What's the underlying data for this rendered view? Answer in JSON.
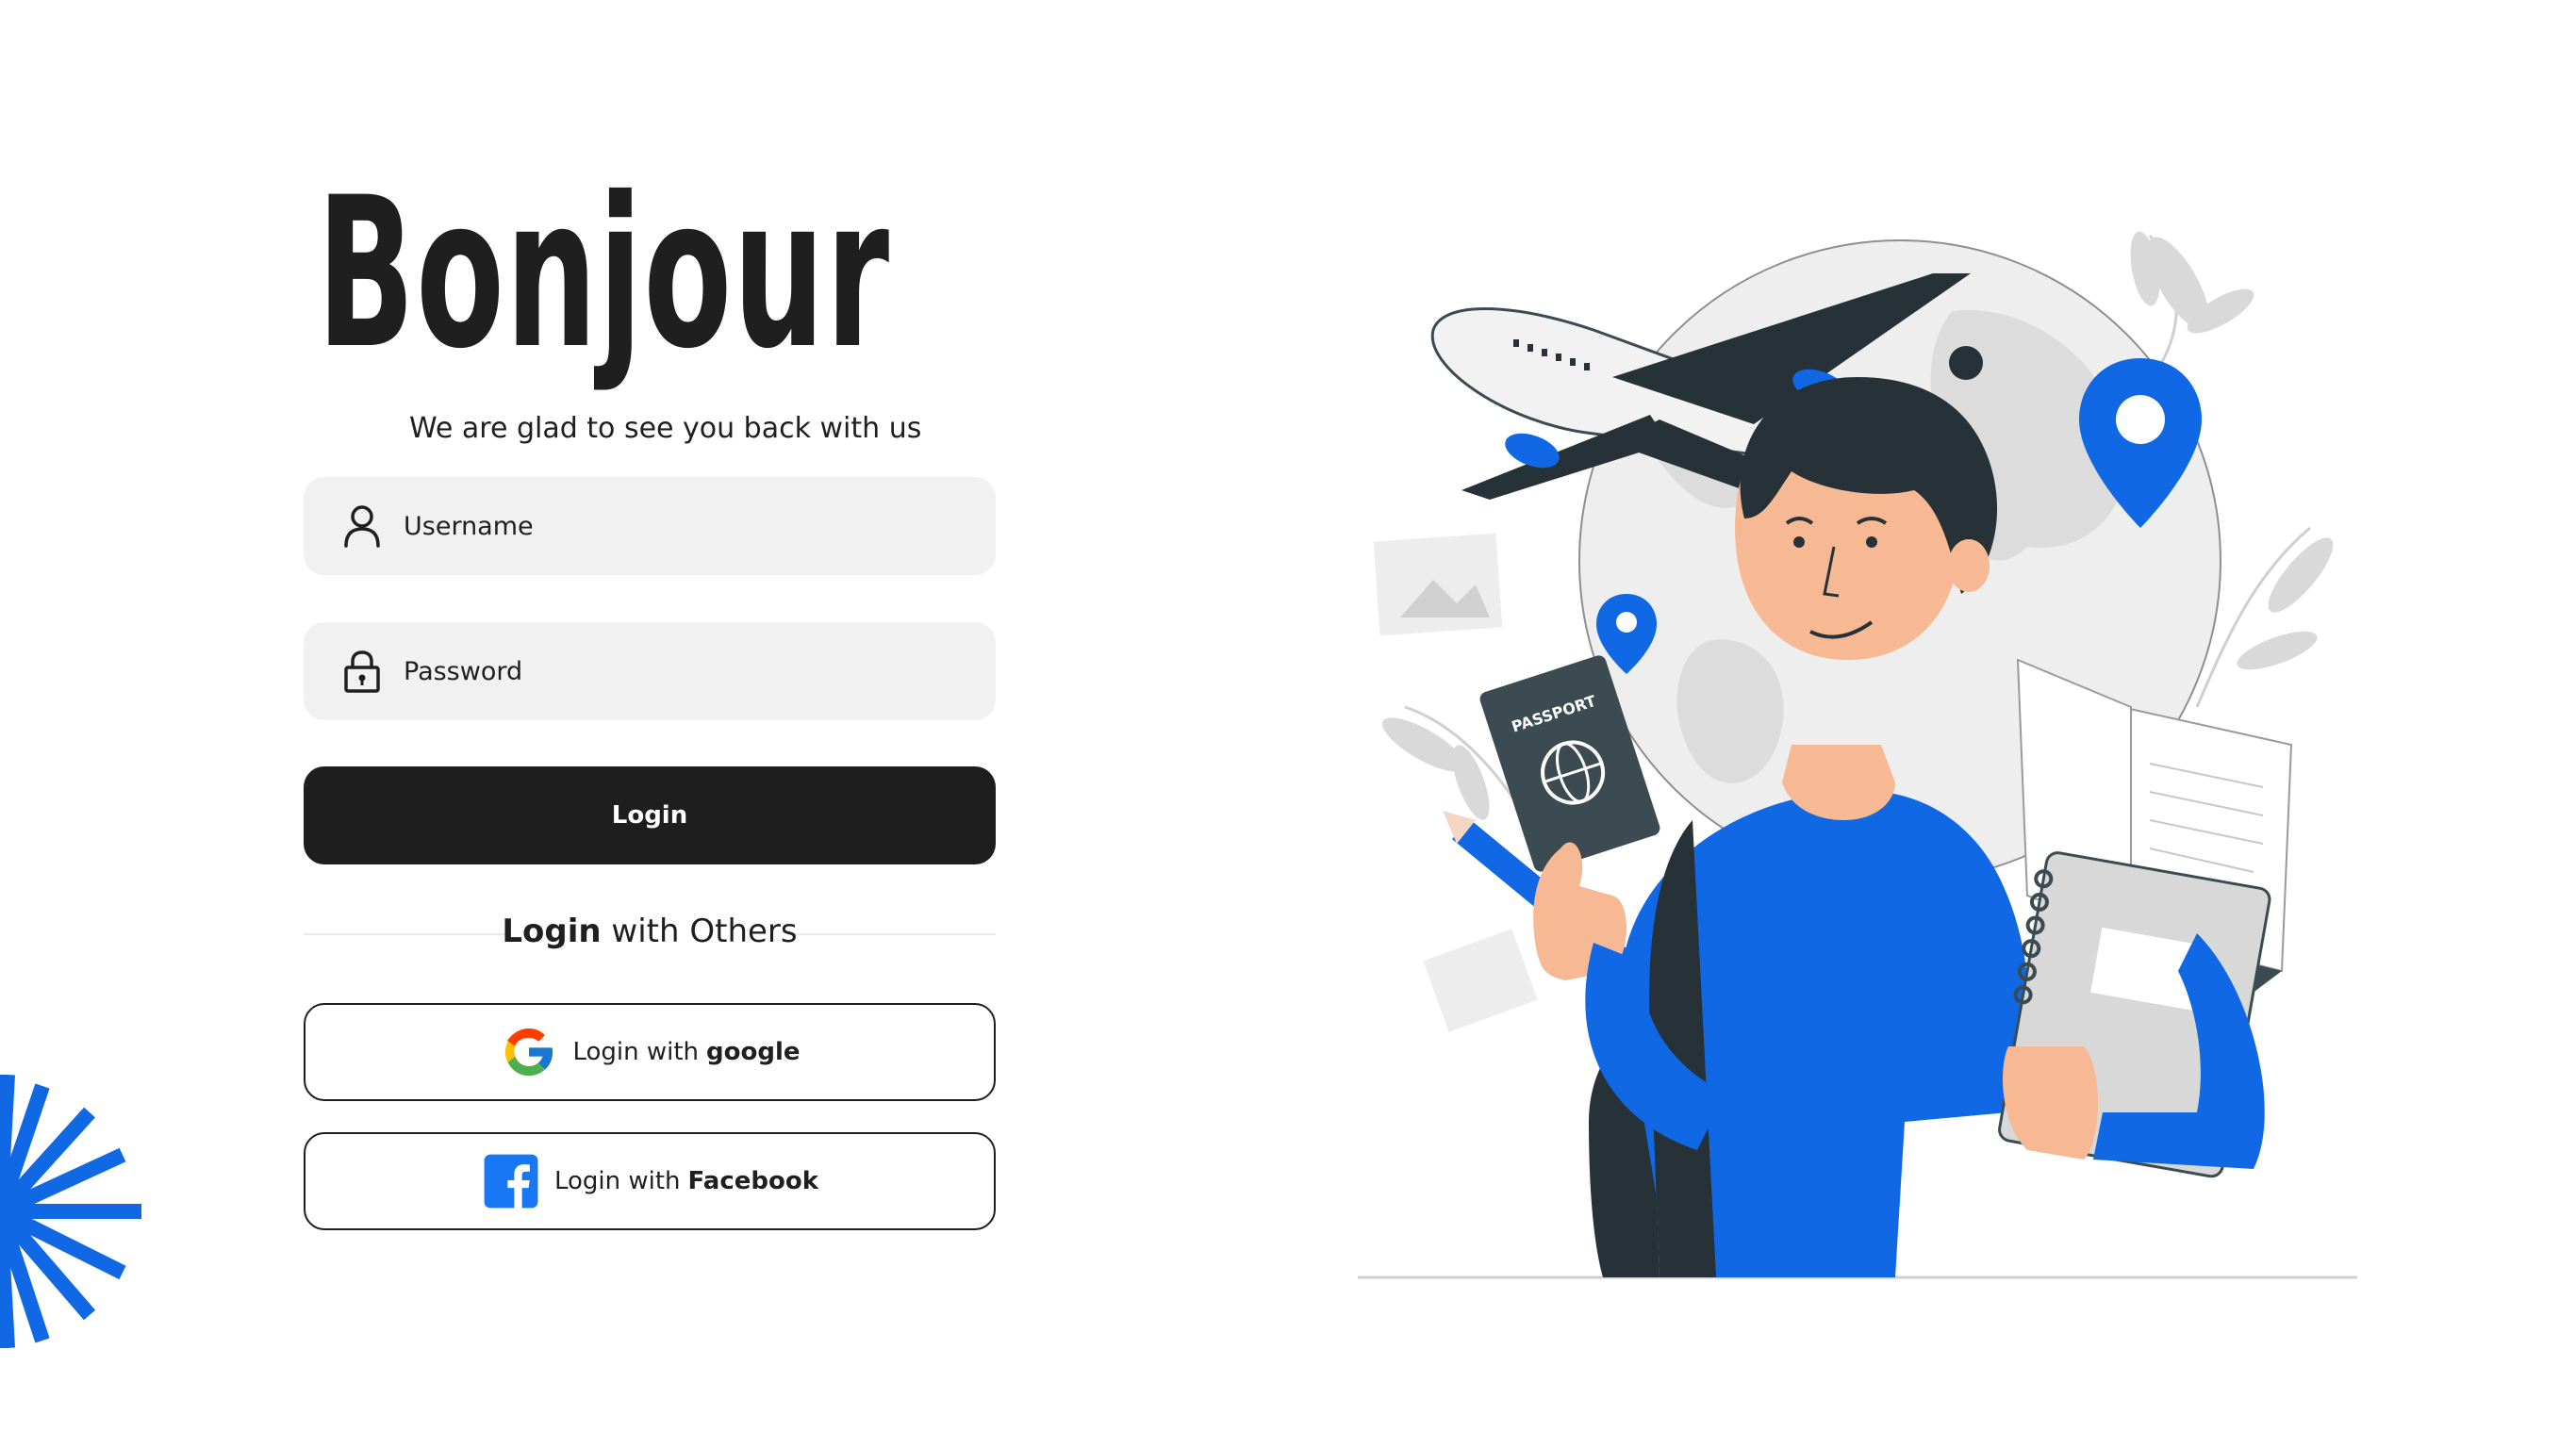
{
  "header": {
    "title": "Bonjour",
    "subtitle": "We are glad to see you back with us"
  },
  "form": {
    "username_placeholder": "Username",
    "password_placeholder": "Password",
    "login_label": "Login"
  },
  "others": {
    "bold": "Login",
    "rest": "with Others"
  },
  "social": {
    "google_prefix": "Login with",
    "google_name": "google",
    "facebook_prefix": "Login with",
    "facebook_name": "Facebook"
  },
  "illustration": {
    "passport_text": "PASSPORT"
  },
  "colors": {
    "accent": "#1168e4",
    "dark": "#1e1e1e",
    "field_bg": "#f1f1f1"
  },
  "icons": [
    "user-icon",
    "lock-icon",
    "google-logo-icon",
    "facebook-logo-icon",
    "burst-decoration-icon"
  ]
}
